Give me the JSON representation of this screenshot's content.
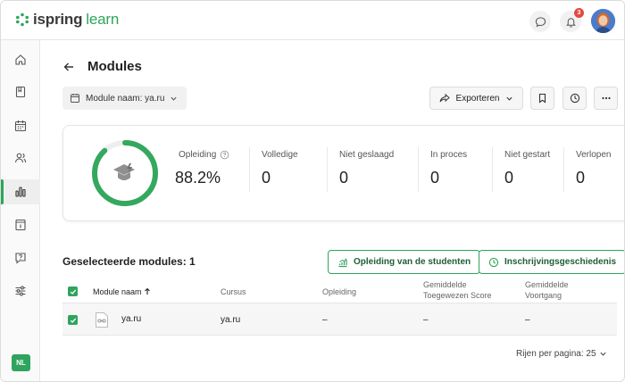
{
  "app": {
    "logo_text": "ispring",
    "logo_accent": "learn",
    "notification_count": "3"
  },
  "sidebar": {
    "items": [
      "home-icon",
      "book-icon",
      "calendar-icon",
      "users-icon",
      "reports-icon",
      "info-icon",
      "help-icon",
      "settings-sliders-icon"
    ],
    "active_index": 4,
    "language": "NL"
  },
  "page": {
    "title": "Modules",
    "filter_label": "Module naam: ya.ru",
    "export_label": "Exporteren"
  },
  "stats": {
    "progress_fraction": 0.882,
    "items": [
      {
        "label": "Opleiding",
        "value": "88.2%"
      },
      {
        "label": "Volledige",
        "value": "0"
      },
      {
        "label": "Niet geslaagd",
        "value": "0"
      },
      {
        "label": "In proces",
        "value": "0"
      },
      {
        "label": "Niet gestart",
        "value": "0"
      },
      {
        "label": "Verlopen",
        "value": "0"
      }
    ]
  },
  "modules": {
    "selected_label": "Geselecteerde modules: 1",
    "students_button": "Opleiding van de studenten",
    "history_button": "Inschrijvingsgeschiedenis",
    "columns": [
      "Module naam",
      "Cursus",
      "Opleiding",
      "Gemiddelde Toegewezen Score",
      "Gemiddelde Voortgang"
    ],
    "rows": [
      {
        "name": "ya.ru",
        "course": "ya.ru",
        "training": "–",
        "score": "–",
        "progress": "–"
      }
    ],
    "rows_per_page": "Rijen per pagina: 25"
  },
  "colors": {
    "accent": "#2fa45c",
    "badge": "#e5483f"
  }
}
